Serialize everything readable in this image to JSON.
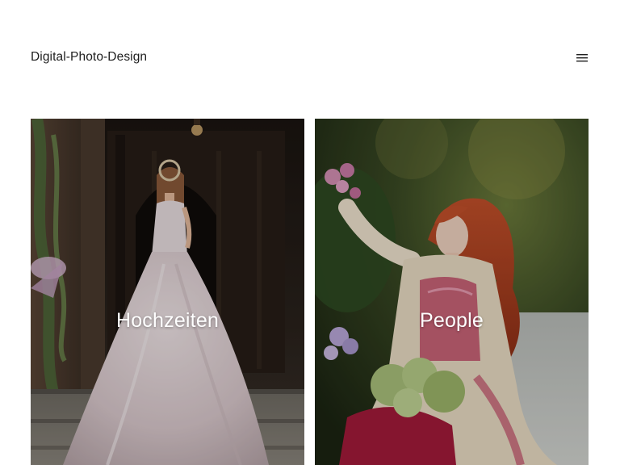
{
  "header": {
    "site_title": "Digital-Photo-Design",
    "menu_icon": "hamburger-menu-icon"
  },
  "gallery": {
    "items": [
      {
        "label": "Hochzeiten",
        "image": "bride-in-white-gown-at-castle-door"
      },
      {
        "label": "People",
        "image": "red-haired-woman-with-flowers-in-garden"
      }
    ]
  },
  "colors": {
    "text": "#1e1e1e",
    "background": "#ffffff",
    "overlay_text": "#ffffff"
  }
}
